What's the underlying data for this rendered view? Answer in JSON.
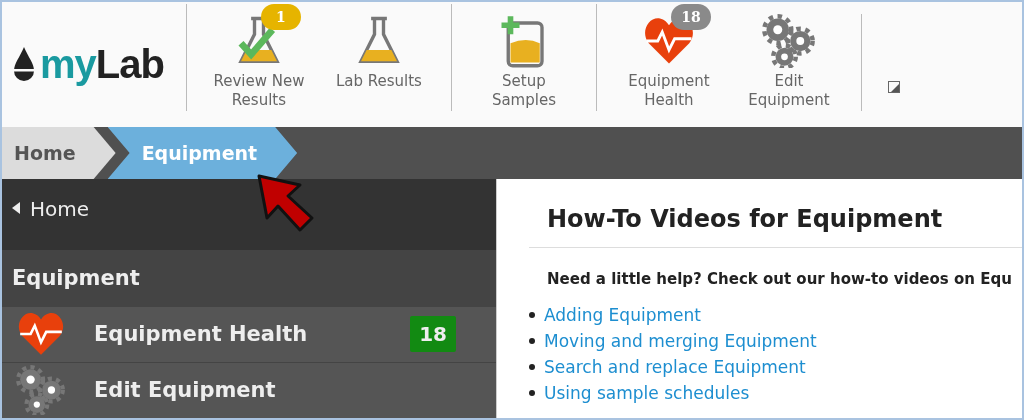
{
  "logo": {
    "prefix": "my",
    "name": "Lab"
  },
  "toolbar": {
    "groups": [
      [
        {
          "label": "Review New Results",
          "kind": "review",
          "badge": "1",
          "color": "#e6b400"
        },
        {
          "label": "Lab Results",
          "kind": "results"
        }
      ],
      [
        {
          "label": "Setup Samples",
          "kind": "setup"
        }
      ],
      [
        {
          "label": "Equipment Health",
          "kind": "health",
          "badge": "18",
          "color": "#8a8a8a"
        },
        {
          "label": "Edit Equipment",
          "kind": "edit"
        }
      ]
    ]
  },
  "breadcrumbs": [
    {
      "label": "Home",
      "selected": false
    },
    {
      "label": "Equipment",
      "selected": true
    }
  ],
  "sidebar": {
    "back": "Home",
    "section": "Equipment",
    "items": [
      {
        "label": "Equipment Health",
        "kind": "health",
        "badge": "18"
      },
      {
        "label": "Edit Equipment",
        "kind": "edit"
      }
    ]
  },
  "content": {
    "title": "How-To Videos for Equipment",
    "intro": "Need a little help? Check out our how-to videos on Equ",
    "links": [
      "Adding Equipment",
      "Moving and merging Equipment",
      "Search and replace Equipment",
      "Using sample schedules"
    ]
  }
}
